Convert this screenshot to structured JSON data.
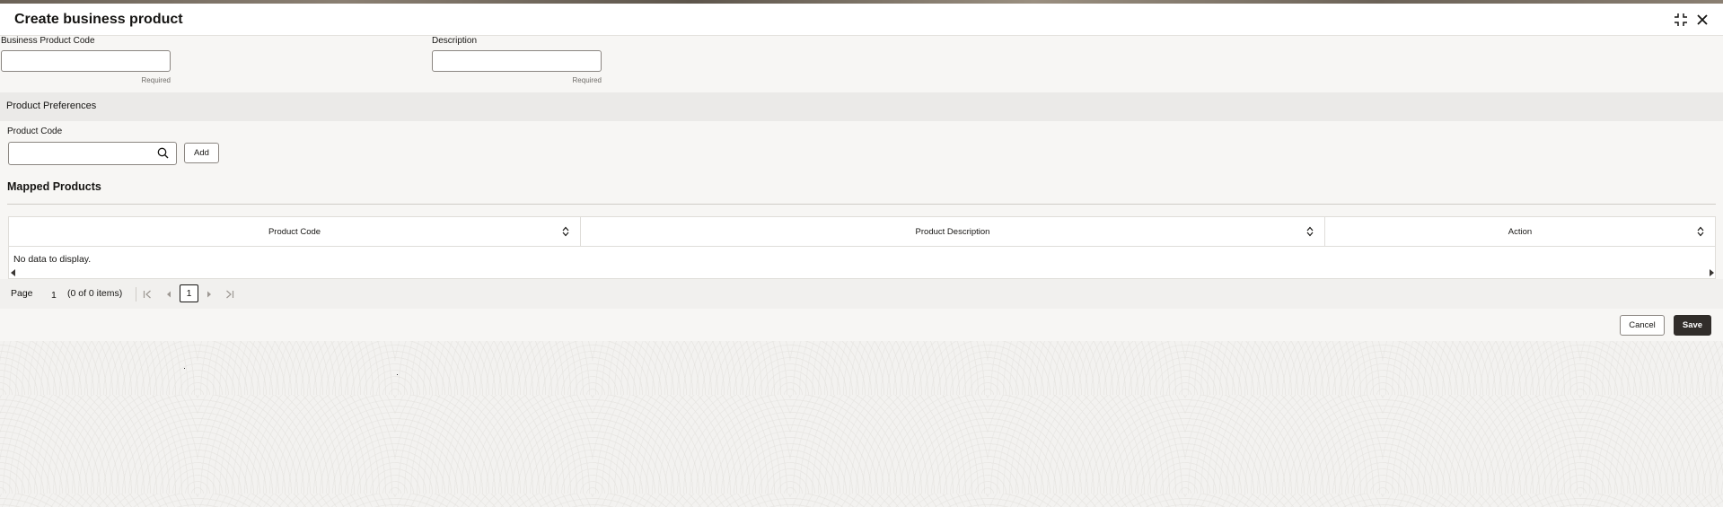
{
  "dialog": {
    "title": "Create business product"
  },
  "form": {
    "business_product_code": {
      "label": "Business Product Code",
      "value": "",
      "hint": "Required"
    },
    "description": {
      "label": "Description",
      "value": "",
      "hint": "Required"
    }
  },
  "tabs": [
    {
      "label": "Product Preferences",
      "active": true
    }
  ],
  "preferences": {
    "product_code_label": "Product Code",
    "product_code_value": "",
    "add_label": "Add",
    "mapped_title": "Mapped Products"
  },
  "table": {
    "columns": [
      "Product Code",
      "Product Description",
      "Action"
    ],
    "empty_text": "No data to display."
  },
  "pagination": {
    "page_label": "Page",
    "page_number": "1",
    "items_text": "(0 of 0 items)",
    "current_page": "1"
  },
  "footer": {
    "cancel_label": "Cancel",
    "save_label": "Save"
  },
  "icons": [
    "collapse-icon",
    "close-icon",
    "search-icon",
    "sort-icon",
    "first-page-icon",
    "previous-page-icon",
    "next-page-icon",
    "last-page-icon",
    "scroll-left-icon",
    "scroll-right-icon"
  ],
  "colors": {
    "primary_button": "#312d2a",
    "page_background": "#f7f6f4",
    "tab_bar": "#ebeae8"
  }
}
